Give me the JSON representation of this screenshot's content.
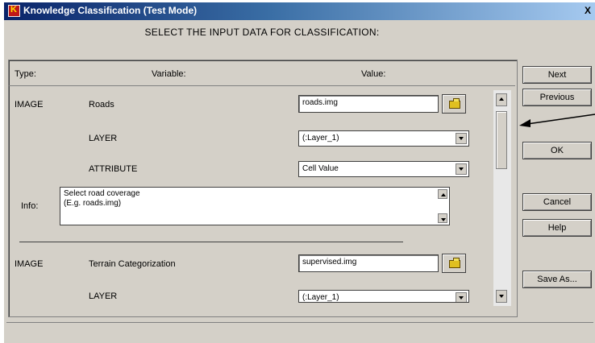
{
  "window": {
    "title": "Knowledge Classification (Test Mode)",
    "close_label": "X"
  },
  "heading": "SELECT THE INPUT DATA FOR CLASSIFICATION:",
  "columns": {
    "type": "Type:",
    "variable": "Variable:",
    "value": "Value:"
  },
  "rows": [
    {
      "type": "IMAGE",
      "variable": "Roads",
      "value": "roads.img"
    },
    {
      "variable": "LAYER",
      "value": "(:Layer_1)"
    },
    {
      "variable": "ATTRIBUTE",
      "value": "Cell Value"
    },
    {
      "type": "IMAGE",
      "variable": "Terrain Categorization",
      "value": "supervised.img"
    },
    {
      "variable": "LAYER",
      "value": "(:Layer_1)"
    }
  ],
  "info": {
    "label": "Info:",
    "line1": "Select road coverage",
    "line2": "(E.g. roads.img)"
  },
  "buttons": {
    "next": "Next",
    "previous": "Previous",
    "ok": "OK",
    "cancel": "Cancel",
    "help": "Help",
    "save_as": "Save As..."
  },
  "icons": {
    "app": "app-icon",
    "browse": "folder-icon"
  }
}
